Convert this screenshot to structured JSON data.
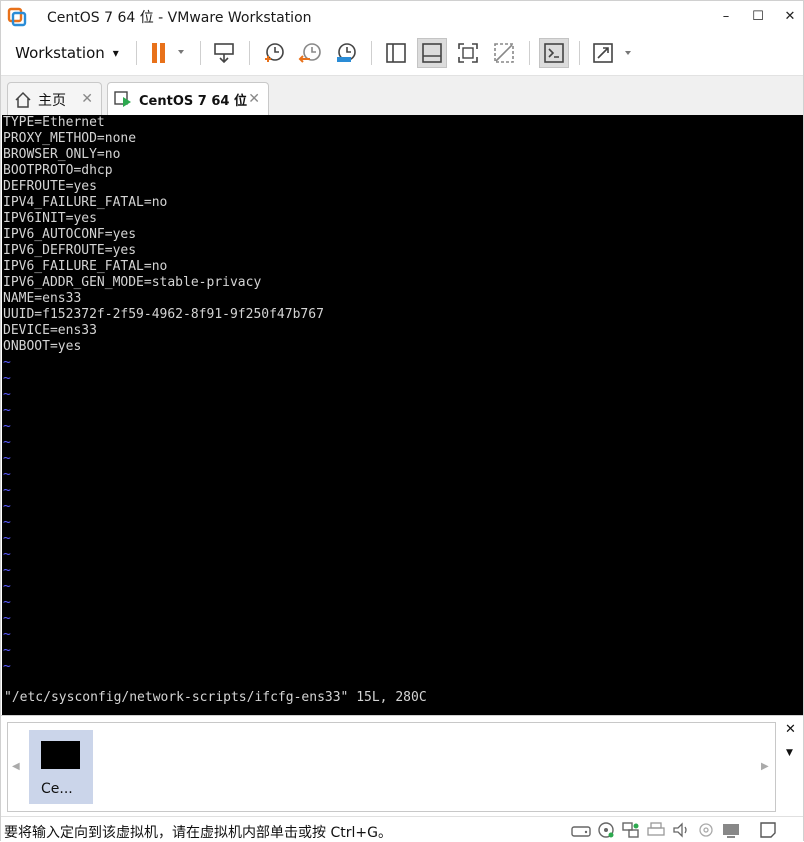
{
  "window": {
    "title": "CentOS 7 64 位 - VMware Workstation",
    "minimize": "–",
    "maximize": "☐",
    "close": "✕"
  },
  "toolbar": {
    "menu_label": "Workstation",
    "menu_arrow": "▾",
    "icons": [
      "pause-icon",
      "send-ctrl-alt-del-icon",
      "snapshot-take-icon",
      "snapshot-revert-icon",
      "snapshot-manager-icon",
      "library-view-icon",
      "thumbnail-bar-icon",
      "full-screen-icon",
      "unity-icon",
      "console-view-icon",
      "stretch-guest-icon"
    ]
  },
  "tabs": [
    {
      "label": "主页",
      "close": "✕"
    },
    {
      "label": "CentOS 7 64 位",
      "close": "✕"
    }
  ],
  "console": {
    "lines": [
      "TYPE=Ethernet",
      "PROXY_METHOD=none",
      "BROWSER_ONLY=no",
      "BOOTPROTO=dhcp",
      "DEFROUTE=yes",
      "IPV4_FAILURE_FATAL=no",
      "IPV6INIT=yes",
      "IPV6_AUTOCONF=yes",
      "IPV6_DEFROUTE=yes",
      "IPV6_FAILURE_FATAL=no",
      "IPV6_ADDR_GEN_MODE=stable-privacy",
      "NAME=ens33",
      "UUID=f152372f-2f59-4962-8f91-9f250f47b767",
      "DEVICE=ens33",
      "ONBOOT=yes"
    ],
    "tilde": "~",
    "tilde_count": 20,
    "status_line": "\"/etc/sysconfig/network-scripts/ifcfg-ens33\" 15L, 280C"
  },
  "library": {
    "thumbnail_label": "Ce...",
    "left_arrow": "◀",
    "right_arrow": "▶",
    "close": "✕",
    "menu_arrow": "▼"
  },
  "statusbar": {
    "message": "要将输入定向到该虚拟机，请在虚拟机内部单击或按 Ctrl+G。"
  },
  "colors": {
    "accent_orange": "#e8711a",
    "console_bg": "#000000",
    "tilde_blue": "#5a5aff",
    "thumb_highlight": "#cbd5ea"
  }
}
